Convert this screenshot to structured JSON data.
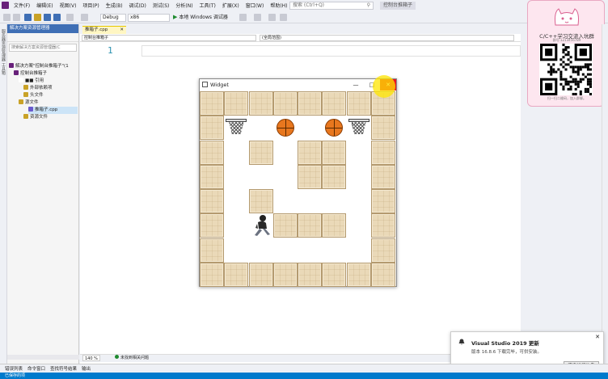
{
  "menubar": {
    "items": [
      "文件(F)",
      "编辑(E)",
      "视图(V)",
      "项目(P)",
      "生成(B)",
      "调试(D)",
      "测试(S)",
      "分析(N)",
      "工具(T)",
      "扩展(X)",
      "窗口(W)",
      "帮助(H)"
    ],
    "search_placeholder": "搜索 (Ctrl+Q)",
    "solution_name": "控制台推箱子"
  },
  "toolbar": {
    "config": "Debug",
    "platform": "x86",
    "run_label": "本地 Windows 调试器"
  },
  "solution_explorer": {
    "header": "解决方案资源管理器",
    "search_placeholder": "搜索解决方案资源管理器(C",
    "tree": [
      {
        "label": "解决方案\"控制台推箱子\"(1",
        "indent": 0,
        "icon_color": "#68217a"
      },
      {
        "label": "控制台推箱子",
        "indent": 1,
        "icon_color": "#68217a"
      },
      {
        "label": "■■ 引用",
        "indent": 2,
        "icon_color": "#ffffff"
      },
      {
        "label": "外部依赖项",
        "indent": 3,
        "icon_color": "#c9a227"
      },
      {
        "label": "头文件",
        "indent": 3,
        "icon_color": "#c9a227"
      },
      {
        "label": "源文件",
        "indent": 2,
        "icon_color": "#c9a227"
      },
      {
        "label": "推箱子.cpp",
        "indent": 4,
        "icon_color": "#6a5acd",
        "selected": true
      },
      {
        "label": "资源文件",
        "indent": 3,
        "icon_color": "#c9a227"
      }
    ]
  },
  "editor": {
    "tab_label": "推箱子.cpp",
    "nav_left": "控制台推箱子",
    "nav_right": "(全局范围)",
    "line_number": "1",
    "zoom": "140 %",
    "issues": "未找到相关问题"
  },
  "widget": {
    "title": "Widget",
    "minimize": "—",
    "maximize": "□",
    "close": "✕"
  },
  "qr_panel": {
    "title": "C/C++学习交流入坑群",
    "subtitle": "群号:1213456789",
    "footer": "扫一扫二维码，加入群聊。"
  },
  "notification": {
    "title": "Visual Studio 2019 更新",
    "body": "版本 16.8.6 下载完毕，可供安装。",
    "button": "查看详细信息"
  },
  "bottom_tabs": [
    "错误列表",
    "命令窗口",
    "查找符号结果",
    "输出"
  ],
  "status_bar": "已保存的项",
  "colors": {
    "accent": "#007acc",
    "wall": "#ead9b8",
    "ball": "#e8771e",
    "close_red": "#e81123",
    "highlight": "#ffe600"
  }
}
